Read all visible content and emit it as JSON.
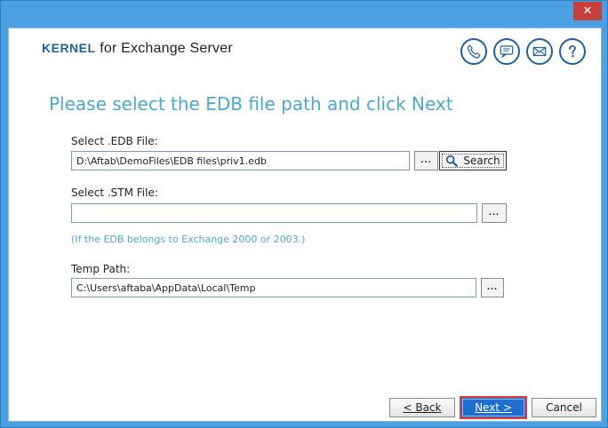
{
  "window": {
    "close_glyph": "✕"
  },
  "brand": {
    "logo_main": "KERNEL",
    "logo_rest": " for Exchange Server"
  },
  "top_icons": [
    "phone-icon",
    "chat-icon",
    "mail-icon",
    "help-icon"
  ],
  "heading": "Please select the EDB file path and click Next",
  "edb": {
    "label": "Select .EDB File:",
    "value": "D:\\Aftab\\DemoFiles\\EDB files\\priv1.edb",
    "browse_label": "...",
    "search_label": "Search"
  },
  "stm": {
    "label": "Select .STM File:",
    "value": "",
    "browse_label": "...",
    "note": "(If the EDB belongs to Exchange 2000 or 2003.)"
  },
  "temp": {
    "label": "Temp Path:",
    "value": "C:\\Users\\aftaba\\AppData\\Local\\Temp",
    "browse_label": "..."
  },
  "buttons": {
    "back": "< Back",
    "next": "Next >",
    "cancel": "Cancel"
  },
  "colors": {
    "accent": "#4ca7d9",
    "brand_blue": "#1f5fa8",
    "highlight_border": "#e53a3a"
  }
}
